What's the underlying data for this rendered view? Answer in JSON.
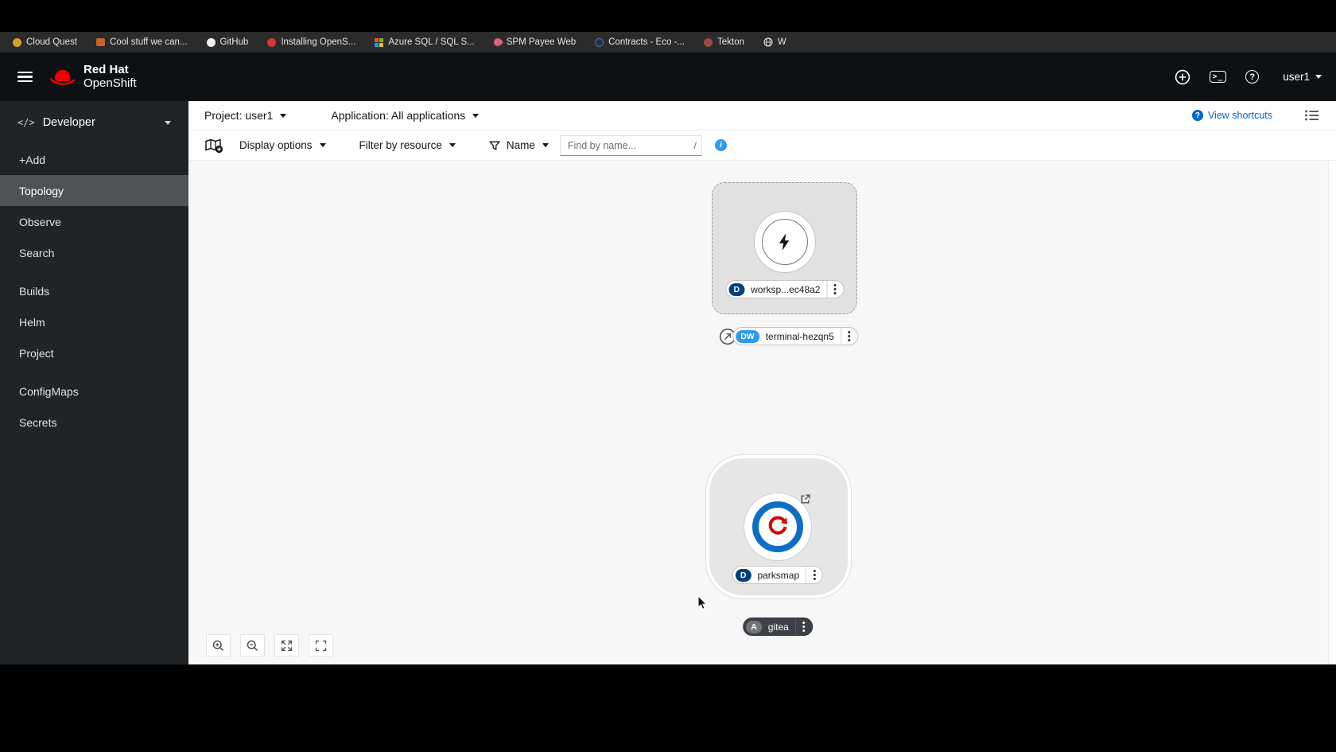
{
  "colors": {
    "accent_blue": "#0066cc",
    "info_blue": "#2b9af3",
    "redhat_red": "#ee0000",
    "masthead_bg": "#0e1113",
    "sidebar_bg": "#212427",
    "sidebar_selected_bg": "#505356",
    "badge_deployment": "#004080",
    "badge_devworkspace": "#2b9af3",
    "badge_application": "#70757a",
    "parksmap_ring": "#0d6ec6"
  },
  "icons": {
    "code_glyph": "</>",
    "terminal_glyph": ">_",
    "question_glyph": "?",
    "info_glyph": "i"
  },
  "bookmarks": {
    "items": [
      {
        "label": "Cloud Quest"
      },
      {
        "label": "Cool stuff we can..."
      },
      {
        "label": "GitHub"
      },
      {
        "label": "Installing OpenS..."
      },
      {
        "label": "Azure SQL / SQL S..."
      },
      {
        "label": "SPM Payee Web"
      },
      {
        "label": "Contracts - Eco -..."
      },
      {
        "label": "Tekton"
      },
      {
        "label": "W"
      }
    ]
  },
  "masthead": {
    "brand_line1": "Red Hat",
    "brand_line2": "OpenShift",
    "user_menu": "user1"
  },
  "sidebar": {
    "perspective": "Developer",
    "items": [
      {
        "label": "+Add"
      },
      {
        "label": "Topology"
      },
      {
        "label": "Observe"
      },
      {
        "label": "Search"
      },
      {
        "label": "Builds"
      },
      {
        "label": "Helm"
      },
      {
        "label": "Project"
      },
      {
        "label": "ConfigMaps"
      },
      {
        "label": "Secrets"
      }
    ]
  },
  "context_bar": {
    "project": "Project: user1",
    "application": "Application: All applications",
    "view_shortcuts": "View shortcuts"
  },
  "toolbar": {
    "display_options": "Display options",
    "filter_by_resource": "Filter by resource",
    "name_filter": "Name",
    "find_placeholder": "Find by name...",
    "shortcut_hint": "/"
  },
  "topology": {
    "workspace": {
      "badge": "D",
      "label": "worksp...ec48a2"
    },
    "terminal": {
      "badge": "DW",
      "label": "terminal-hezqn5"
    },
    "parksmap": {
      "badge": "D",
      "label": "parksmap"
    },
    "gitea": {
      "badge": "A",
      "label": "gitea"
    }
  }
}
